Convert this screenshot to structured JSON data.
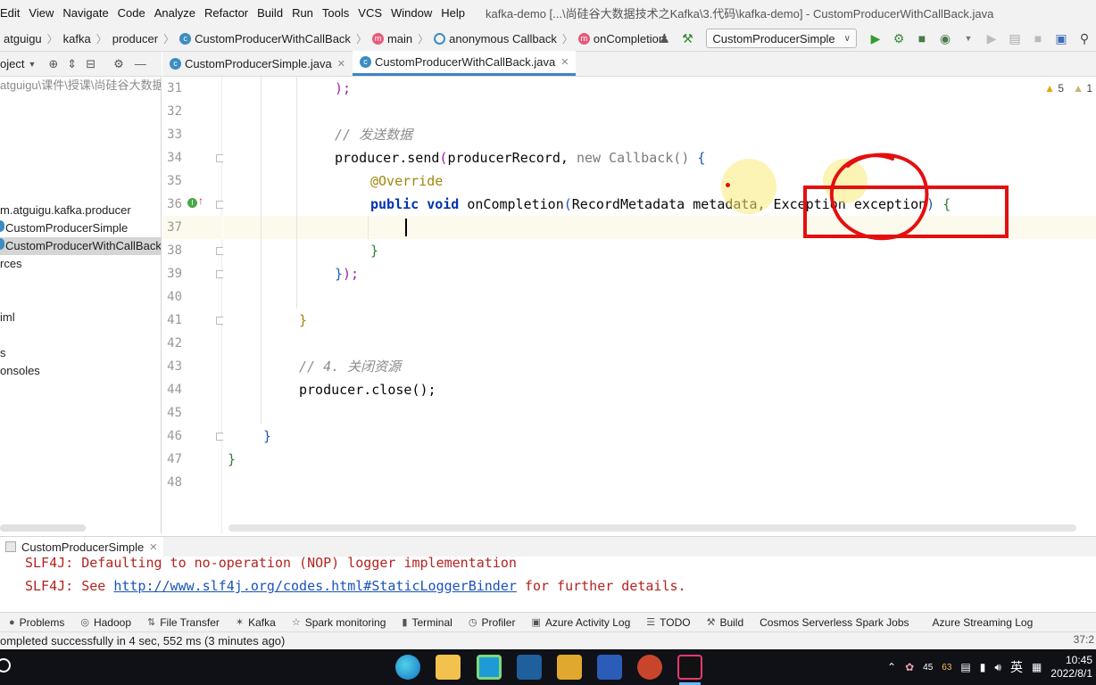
{
  "menu": {
    "items": [
      "Edit",
      "View",
      "Navigate",
      "Code",
      "Analyze",
      "Refactor",
      "Build",
      "Run",
      "Tools",
      "VCS",
      "Window",
      "Help"
    ],
    "window_title": "kafka-demo [...\\尚硅谷大数据技术之Kafka\\3.代码\\kafka-demo] - CustomProducerWithCallBack.java"
  },
  "breadcrumb": {
    "items": [
      "atguigu",
      "kafka",
      "producer",
      "CustomProducerWithCallBack",
      "main",
      "anonymous Callback",
      "onCompletion"
    ]
  },
  "run_config": {
    "label": "CustomProducerSimple"
  },
  "project": {
    "header_label": "oject",
    "rows": [
      "atguigu\\课件\\授课\\尚硅谷大数据",
      "m.atguigu.kafka.producer",
      "CustomProducerSimple",
      "CustomProducerWithCallBack",
      "rces",
      "iml",
      "s",
      "onsoles"
    ]
  },
  "tabs": [
    {
      "label": "CustomProducerSimple.java"
    },
    {
      "label": "CustomProducerWithCallBack.java"
    }
  ],
  "inspection": {
    "warnings": "5",
    "weak_warnings": "1"
  },
  "code": {
    "line_numbers": [
      "31",
      "32",
      "33",
      "34",
      "35",
      "36",
      "37",
      "38",
      "39",
      "40",
      "41",
      "42",
      "43",
      "44",
      "45",
      "46",
      "47",
      "48"
    ],
    "l31": ");",
    "l33": "// 发送数据",
    "l34_a": "producer.send",
    "l34_b": "(",
    "l34_c": "producerRecord, ",
    "l34_kw": "new",
    "l34_d": " Callback() ",
    "l34_e": "{",
    "l35": "@Override",
    "l36_kw1": "public",
    "l36_kw2": "void",
    "l36_a": " onCompletion",
    "l36_b": "(",
    "l36_c": "RecordMetadata metadata, Exception exception",
    "l36_d": ")",
    "l36_e": " {",
    "l38": "}",
    "l39_a": "}",
    "l39_b": ");",
    "l41": "}",
    "l43": "// 4. 关闭资源",
    "l44": "producer.close();",
    "l46": "}",
    "l47": "}"
  },
  "run_panel": {
    "tab_label": "CustomProducerSimple",
    "line1": "SLF4J: Defaulting to no-operation (NOP) logger implementation",
    "line2_a": "SLF4J: See ",
    "line2_link": "http://www.slf4j.org/codes.html#StaticLoggerBinder",
    "line2_b": " for further details."
  },
  "tool_windows": [
    "Problems",
    "Hadoop",
    "File Transfer",
    "Kafka",
    "Spark monitoring",
    "Terminal",
    "Profiler",
    "Azure Activity Log",
    "TODO",
    "Build",
    "Cosmos Serverless Spark Jobs",
    "Azure Streaming Log"
  ],
  "status": {
    "message": "ompleted successfully in 4 sec, 552 ms (3 minutes ago)",
    "position": "37:2"
  },
  "taskbar": {
    "tray_num1": "45",
    "tray_num2": "63",
    "ime": "英",
    "time": "10:45",
    "date": "2022/8/1"
  },
  "colors": {
    "keyword": "#0033b3",
    "annotation": "#9e880d",
    "comment": "#8c8c8c",
    "console_error": "#b4231f",
    "annotation_red": "#e31010"
  }
}
